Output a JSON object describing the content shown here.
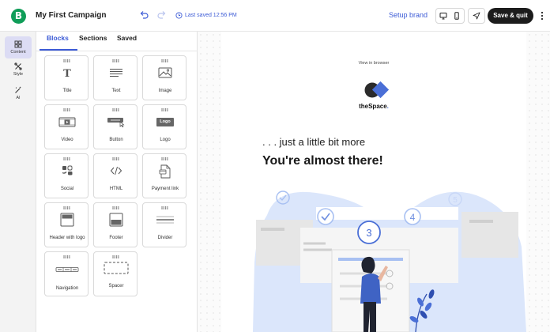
{
  "header": {
    "logo_letter": "B",
    "campaign_name": "My First Campaign",
    "last_saved": "Last saved 12:56 PM",
    "setup_brand": "Setup brand",
    "save_quit": "Save & quit"
  },
  "rail": {
    "items": [
      {
        "label": "Content",
        "icon": "grid-icon"
      },
      {
        "label": "Style",
        "icon": "brush-icon"
      },
      {
        "label": "AI",
        "icon": "magic-wand-icon"
      }
    ]
  },
  "panel": {
    "tabs": [
      "Blocks",
      "Sections",
      "Saved"
    ],
    "blocks": [
      {
        "label": "Title",
        "icon": "title-icon"
      },
      {
        "label": "Text",
        "icon": "text-icon"
      },
      {
        "label": "Image",
        "icon": "image-icon"
      },
      {
        "label": "Video",
        "icon": "video-icon"
      },
      {
        "label": "Button",
        "icon": "button-icon"
      },
      {
        "label": "Logo",
        "icon": "logo-icon",
        "badge": "Logo"
      },
      {
        "label": "Social",
        "icon": "social-icon"
      },
      {
        "label": "HTML",
        "icon": "html-icon"
      },
      {
        "label": "Payment link",
        "icon": "payment-link-icon"
      },
      {
        "label": "Header with logo",
        "icon": "header-with-logo-icon"
      },
      {
        "label": "Footer",
        "icon": "footer-icon"
      },
      {
        "label": "Divider",
        "icon": "divider-icon"
      },
      {
        "label": "Navigation",
        "icon": "navigation-icon"
      },
      {
        "label": "Spacer",
        "icon": "spacer-icon"
      }
    ]
  },
  "email": {
    "view_in_browser": "View in browser",
    "brand_name": "theSpace",
    "brand_dot": ".",
    "subtitle": ". . . just a little bit more",
    "headline": "You're almost there!",
    "steps": [
      "3",
      "4",
      "5"
    ]
  },
  "colors": {
    "accent": "#3c5bd6",
    "brand_green": "#0f9d58",
    "dark_button": "#1c1c1c",
    "illustration_blue": "#dbe6fb"
  }
}
